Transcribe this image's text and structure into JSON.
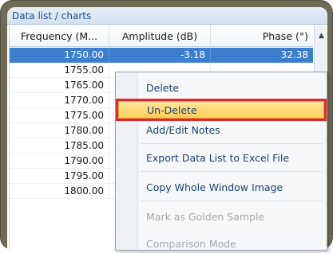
{
  "window": {
    "title": "Data list / charts"
  },
  "table": {
    "columns": [
      "Frequency (M...",
      "Amplitude (dB)",
      "Phase (°)"
    ],
    "selected_row": {
      "frequency": "1750.00",
      "amplitude": "-3.18",
      "phase": "32.38"
    },
    "rows": [
      "1755.00",
      "1765.00",
      "1770.00",
      "1775.00",
      "1780.00",
      "1785.00",
      "1790.00",
      "1795.00",
      "1800.00"
    ]
  },
  "context_menu": {
    "items": [
      "Delete",
      "Un-Delete",
      "Add/Edit Notes",
      "Export Data List to Excel File",
      "Copy Whole Window Image",
      "Mark as Golden Sample",
      "Comparison Mode"
    ],
    "highlighted": "Un-Delete"
  },
  "colors": {
    "frame": "#6e6b56",
    "selection": "#3d7fcf",
    "menu_highlight": "#ffcf5a",
    "callout": "#e0282f"
  }
}
